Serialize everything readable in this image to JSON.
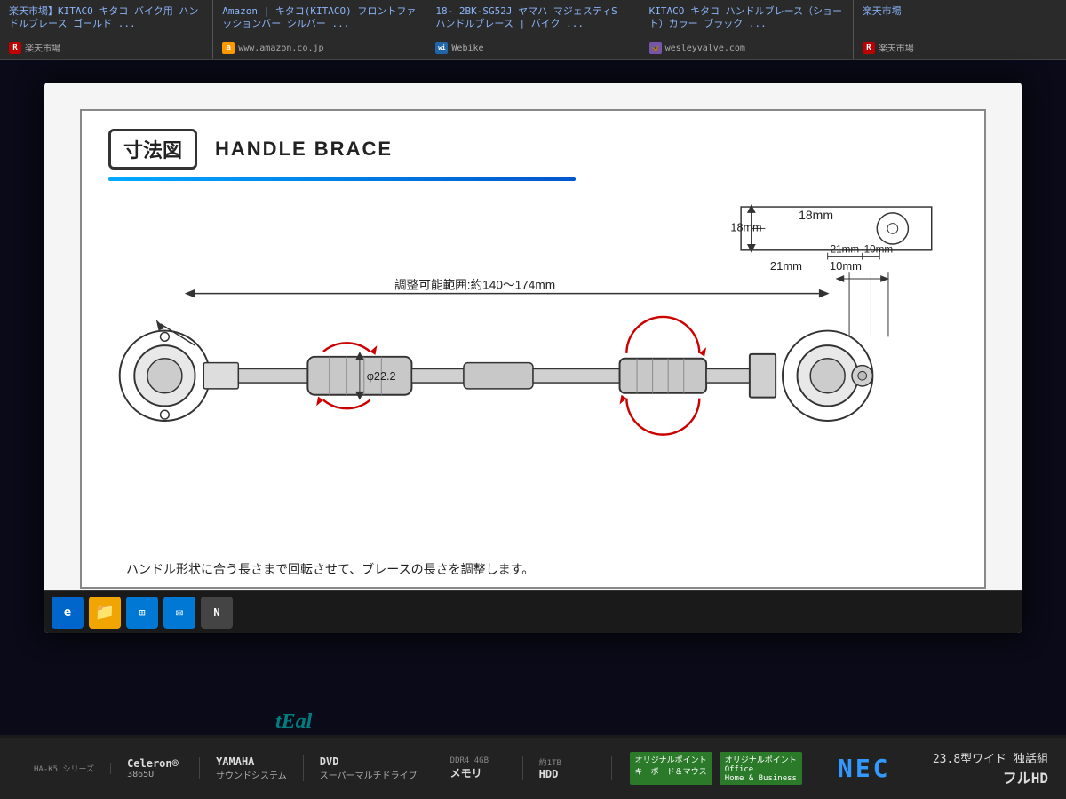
{
  "search_bar": {
    "items": [
      {
        "title": "楽天市場】KITACO キタコ バイク用 ハンドルブレース ゴールド ...",
        "source": "楽天市場",
        "icon_type": "rakuten"
      },
      {
        "title": "Amazon | キタコ(KITACO) フロントファッションバー シルバー ...",
        "source": "www.amazon.co.jp",
        "icon_type": "amazon"
      },
      {
        "title": "18- 2BK-SG52J ヤマハ マジェスティS ハンドルブレース | バイク ...",
        "source": "Webike",
        "icon_type": "webike"
      },
      {
        "title": "KITACO キタコ ハンドルブレース（ショート）カラー ブラック ...",
        "source": "wesleyvalve.com",
        "icon_type": "wesley"
      },
      {
        "title": "楽天市場",
        "source": "楽天市場",
        "icon_type": "rakuten"
      }
    ]
  },
  "diagram": {
    "title_jp": "寸法図",
    "title_en": "HANDLE BRACE",
    "dim_18mm": "18mm",
    "dim_21mm": "21mm",
    "dim_10mm": "10mm",
    "range_label": "調整可能範囲:約140〜174mm",
    "phi_label": "φ22.2",
    "caption": "ハンドル形状に合う長さまで回転させて、ブレースの長さを調整します。"
  },
  "taskbar": {
    "icons": [
      "🌐",
      "📁",
      "🪟",
      "📧",
      "📰"
    ]
  },
  "laptop_specs": [
    {
      "label": "HA-K5 シリーズ",
      "value": "Celeron®",
      "sub": "3865U"
    },
    {
      "label": "",
      "value": "YAMAHA",
      "sub": "サウンドシステム"
    },
    {
      "label": "",
      "value": "DVD",
      "sub": "スーパーマルチドライブ"
    },
    {
      "label": "DDR4 4GB",
      "value": "メモリ",
      "sub": ""
    },
    {
      "label": "約1TB",
      "value": "HDD",
      "sub": ""
    }
  ],
  "nec_label": "NEC",
  "monitor_label": "23.8型ワイド 独話組",
  "fullhd_label": "フルHD",
  "teal_watermark": "tEal"
}
